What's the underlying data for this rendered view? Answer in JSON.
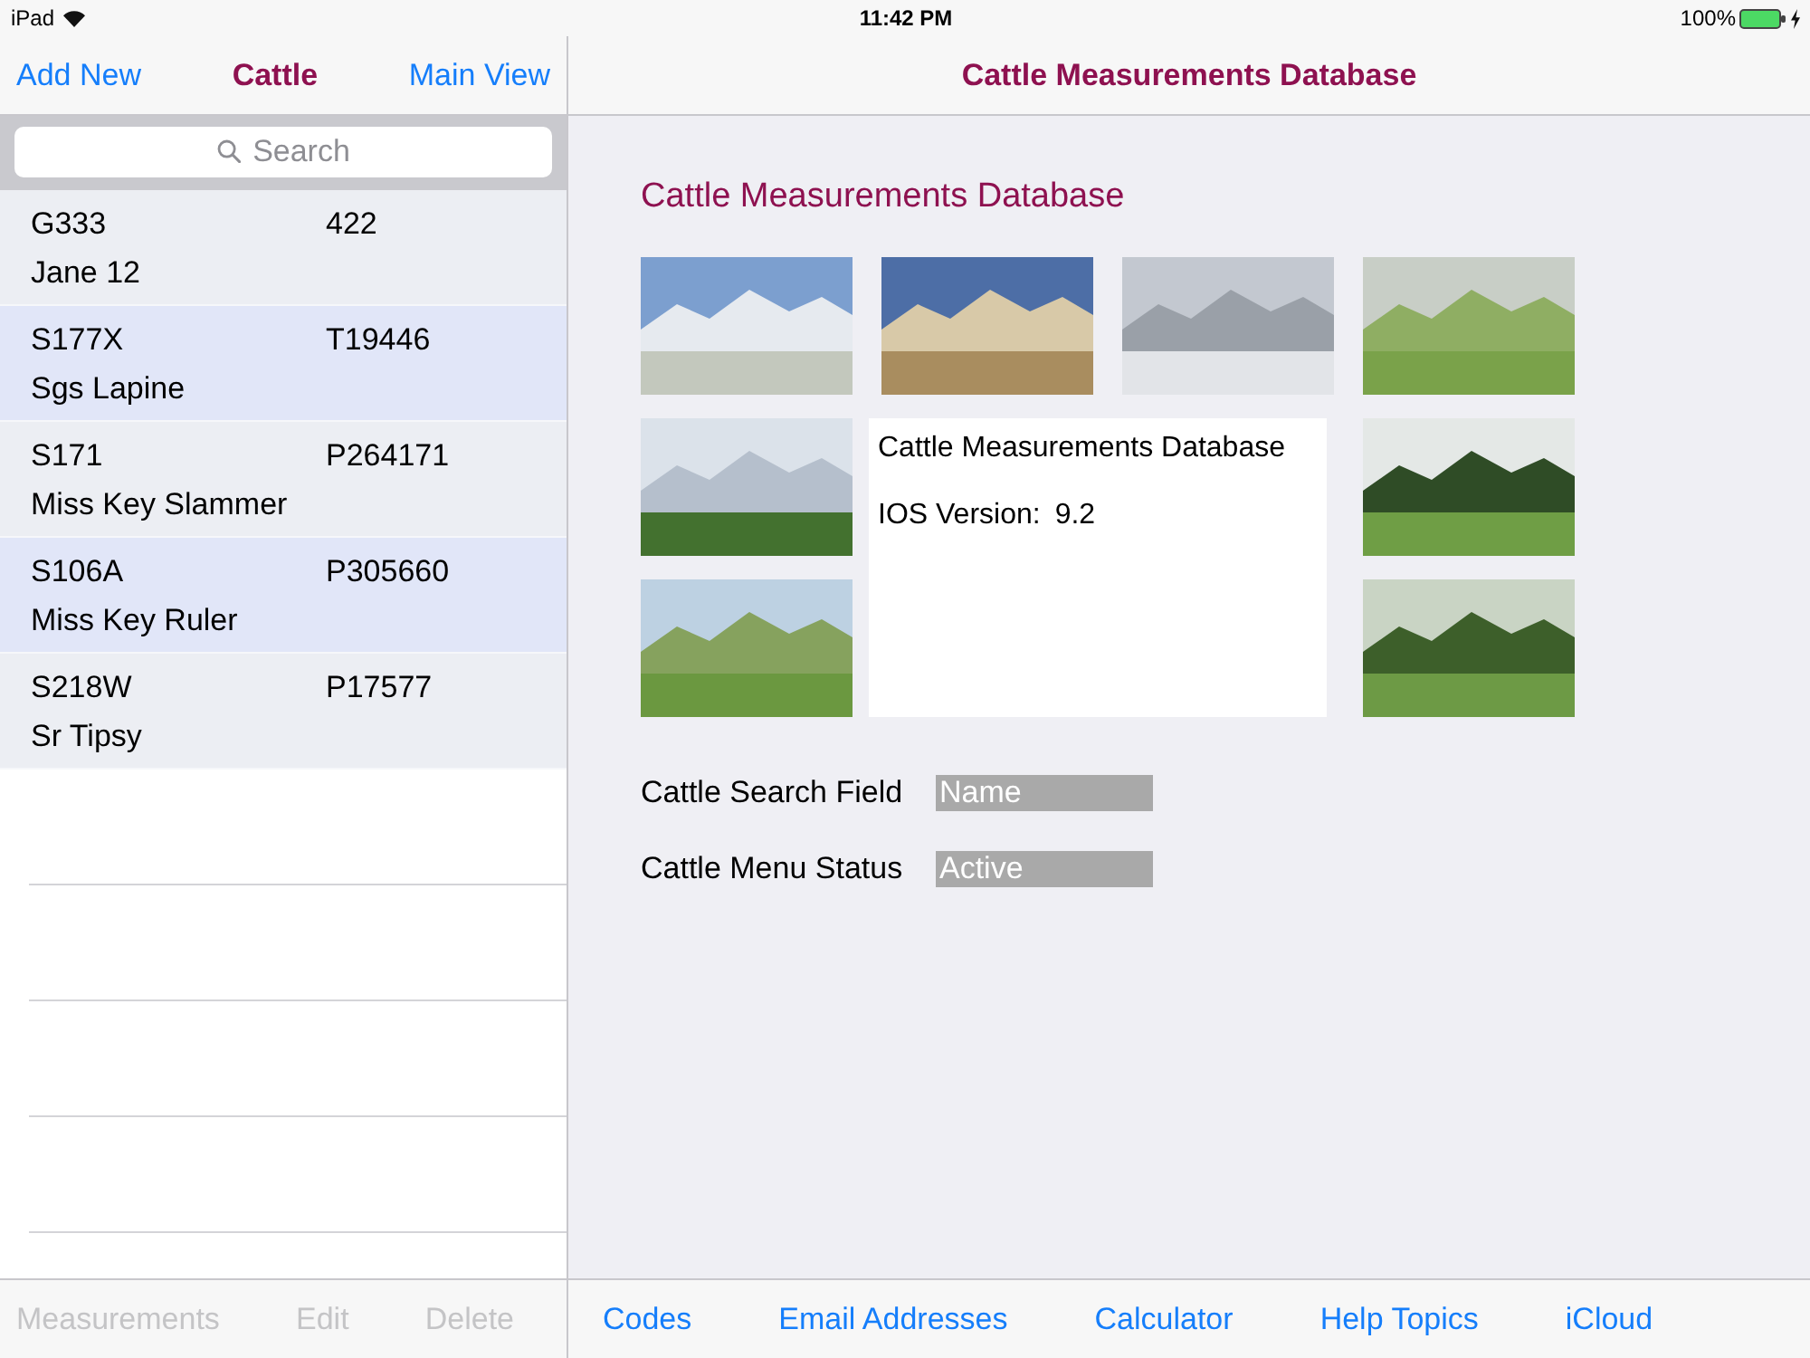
{
  "status_bar": {
    "carrier": "iPad",
    "time": "11:42 PM",
    "battery": "100%"
  },
  "sidebar": {
    "nav": {
      "left_button": "Add New",
      "title": "Cattle",
      "right_button": "Main View"
    },
    "search": {
      "placeholder": "Search"
    },
    "rows": [
      {
        "code": "G333",
        "number": "422",
        "name": "Jane 12"
      },
      {
        "code": "S177X",
        "number": "T19446",
        "name": "Sgs Lapine"
      },
      {
        "code": "S171",
        "number": "P264171",
        "name": "Miss Key Slammer"
      },
      {
        "code": "S106A",
        "number": "P305660",
        "name": "Miss Key Ruler"
      },
      {
        "code": "S218W",
        "number": "P17577",
        "name": "Sr Tipsy"
      }
    ],
    "toolbar": [
      {
        "label": "Measurements",
        "disabled": true
      },
      {
        "label": "Edit",
        "disabled": true
      },
      {
        "label": "Delete",
        "disabled": true
      }
    ]
  },
  "detail": {
    "nav_title": "Cattle Measurements Database",
    "heading": "Cattle Measurements Database",
    "info_box": {
      "title": "Cattle Measurements Database",
      "version_label": "IOS Version:",
      "version_value": "9.2"
    },
    "fields": [
      {
        "label": "Cattle Search Field",
        "value": "Name"
      },
      {
        "label": "Cattle Menu Status",
        "value": "Active"
      }
    ],
    "toolbar": [
      {
        "label": "Codes",
        "disabled": false
      },
      {
        "label": "Email Addresses",
        "disabled": false
      },
      {
        "label": "Calculator",
        "disabled": false
      },
      {
        "label": "Help Topics",
        "disabled": false
      },
      {
        "label": "iCloud",
        "disabled": false
      }
    ]
  }
}
